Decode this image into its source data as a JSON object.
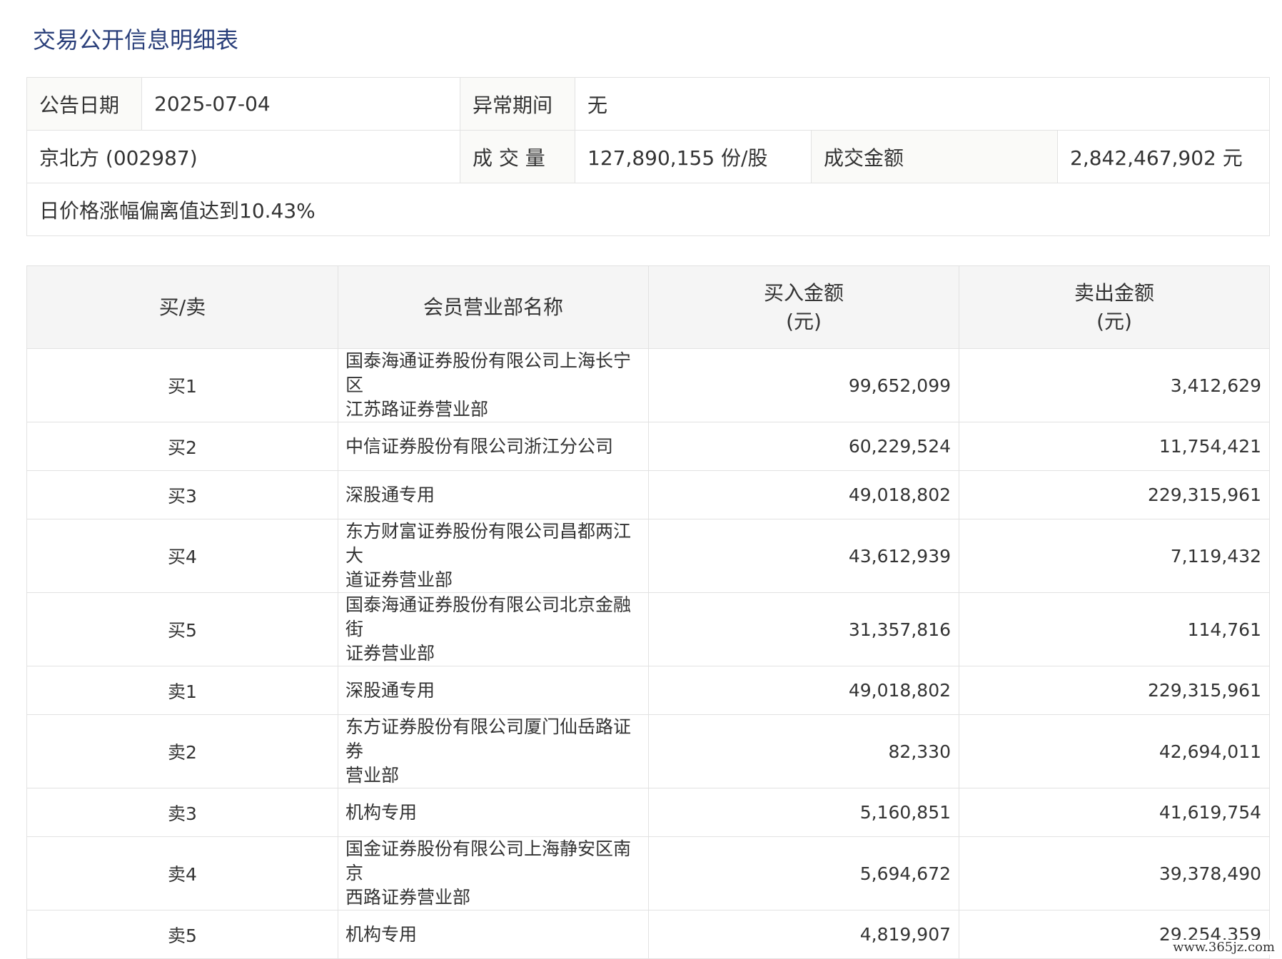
{
  "title": "交易公开信息明细表",
  "info": {
    "announce_date_label": "公告日期",
    "announce_date": "2025-07-04",
    "abnormal_period_label": "异常期间",
    "abnormal_period": "无",
    "stock_name": "京北方 (002987)",
    "volume_label": "成 交 量",
    "volume": "127,890,155 份/股",
    "amount_label": "成交金额",
    "amount": "2,842,467,902 元",
    "reason": "日价格涨幅偏离值达到10.43%"
  },
  "table": {
    "headers": {
      "side": "买/卖",
      "member": "会员营业部名称",
      "buy_line1": "买入金额",
      "buy_line2": "(元)",
      "sell_line1": "卖出金额",
      "sell_line2": "(元)"
    },
    "rows": [
      {
        "side": "买1",
        "name_line1": "国泰海通证券股份有限公司上海长宁区",
        "name_line2": "江苏路证券营业部",
        "buy": "99,652,099",
        "sell": "3,412,629"
      },
      {
        "side": "买2",
        "name_line1": "中信证券股份有限公司浙江分公司",
        "name_line2": "",
        "buy": "60,229,524",
        "sell": "11,754,421"
      },
      {
        "side": "买3",
        "name_line1": "深股通专用",
        "name_line2": "",
        "buy": "49,018,802",
        "sell": "229,315,961"
      },
      {
        "side": "买4",
        "name_line1": "东方财富证券股份有限公司昌都两江大",
        "name_line2": "道证券营业部",
        "buy": "43,612,939",
        "sell": "7,119,432"
      },
      {
        "side": "买5",
        "name_line1": "国泰海通证券股份有限公司北京金融街",
        "name_line2": "证券营业部",
        "buy": "31,357,816",
        "sell": "114,761"
      },
      {
        "side": "卖1",
        "name_line1": "深股通专用",
        "name_line2": "",
        "buy": "49,018,802",
        "sell": "229,315,961"
      },
      {
        "side": "卖2",
        "name_line1": "东方证券股份有限公司厦门仙岳路证券",
        "name_line2": "营业部",
        "buy": "82,330",
        "sell": "42,694,011"
      },
      {
        "side": "卖3",
        "name_line1": "机构专用",
        "name_line2": "",
        "buy": "5,160,851",
        "sell": "41,619,754"
      },
      {
        "side": "卖4",
        "name_line1": "国金证券股份有限公司上海静安区南京",
        "name_line2": "西路证券营业部",
        "buy": "5,694,672",
        "sell": "39,378,490"
      },
      {
        "side": "卖5",
        "name_line1": "机构专用",
        "name_line2": "",
        "buy": "4,819,907",
        "sell": "29,254,359"
      }
    ]
  },
  "watermark": "www.365jz.com"
}
